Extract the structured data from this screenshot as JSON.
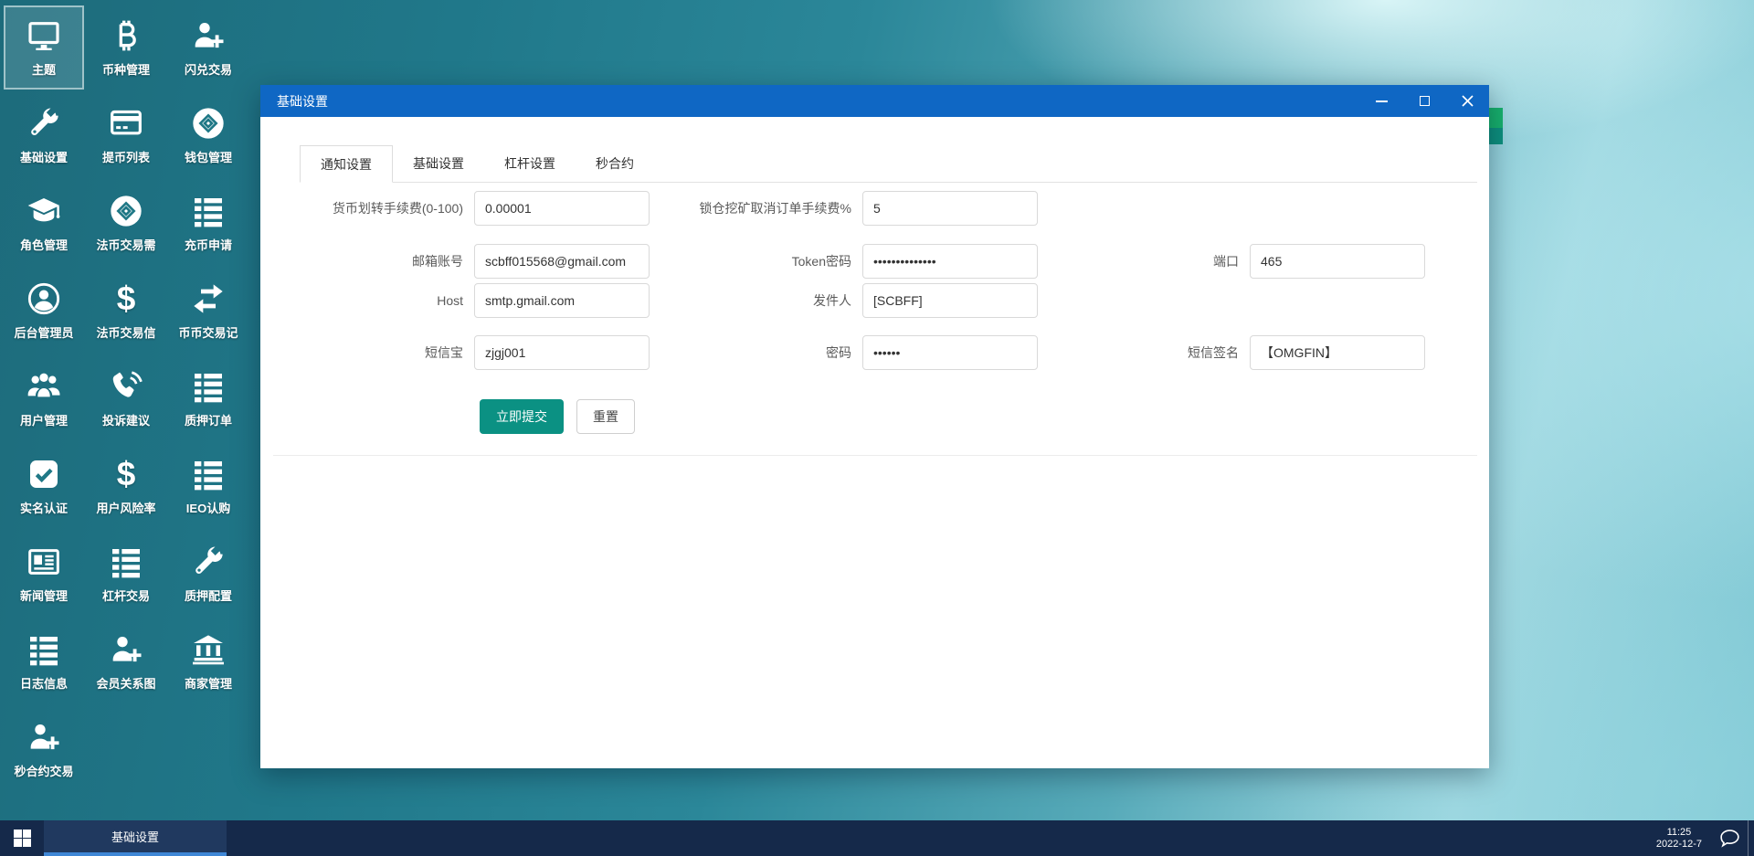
{
  "desktop": {
    "shortcuts": [
      {
        "label": "主题",
        "icon": "monitor-icon",
        "selected": true
      },
      {
        "label": "币种管理",
        "icon": "bitcoin-icon"
      },
      {
        "label": "闪兑交易",
        "icon": "user-plus-icon"
      },
      {
        "label": "基础设置",
        "icon": "wrench-icon"
      },
      {
        "label": "提币列表",
        "icon": "credit-card-icon"
      },
      {
        "label": "钱包管理",
        "icon": "coin-link-icon"
      },
      {
        "label": "角色管理",
        "icon": "graduation-cap-icon"
      },
      {
        "label": "法币交易需",
        "icon": "coin-link-icon"
      },
      {
        "label": "充币申请",
        "icon": "list-icon"
      },
      {
        "label": "后台管理员",
        "icon": "user-circle-icon"
      },
      {
        "label": "法币交易信",
        "icon": "dollar-icon"
      },
      {
        "label": "币币交易记",
        "icon": "swap-arrows-icon"
      },
      {
        "label": "用户管理",
        "icon": "users-icon"
      },
      {
        "label": "投诉建议",
        "icon": "phone-sound-icon"
      },
      {
        "label": "质押订单",
        "icon": "list-icon"
      },
      {
        "label": "实名认证",
        "icon": "check-square-icon"
      },
      {
        "label": "用户风险率",
        "icon": "dollar-icon"
      },
      {
        "label": "IEO认购",
        "icon": "list-icon"
      },
      {
        "label": "新闻管理",
        "icon": "newspaper-icon"
      },
      {
        "label": "杠杆交易",
        "icon": "list-icon"
      },
      {
        "label": "质押配置",
        "icon": "wrench-icon"
      },
      {
        "label": "日志信息",
        "icon": "list-icon"
      },
      {
        "label": "会员关系图",
        "icon": "user-plus-icon"
      },
      {
        "label": "商家管理",
        "icon": "bank-icon"
      },
      {
        "label": "秒合约交易",
        "icon": "user-plus-icon"
      }
    ]
  },
  "window": {
    "title": "基础设置",
    "tabs": [
      {
        "label": "通知设置",
        "active": true
      },
      {
        "label": "基础设置",
        "active": false
      },
      {
        "label": "杠杆设置",
        "active": false
      },
      {
        "label": "秒合约",
        "active": false
      }
    ]
  },
  "form": {
    "rows": [
      [
        {
          "col": 1,
          "label": "货币划转手续费(0-100)",
          "value": "0.00001"
        },
        {
          "col": 2,
          "label": "锁仓挖矿取消订单手续费%",
          "value": "5"
        }
      ],
      [
        {
          "col": 1,
          "label": "邮箱账号",
          "value": "scbff015568@gmail.com"
        },
        {
          "col": 2,
          "label": "Token密码",
          "value": "••••••••••••••"
        },
        {
          "col": 3,
          "label": "端口",
          "value": "465"
        }
      ],
      [
        {
          "col": 1,
          "label": "Host",
          "value": "smtp.gmail.com"
        },
        {
          "col": 2,
          "label": "发件人",
          "value": "[SCBFF]"
        }
      ],
      [
        {
          "col": 1,
          "label": "短信宝",
          "value": "zjgj001"
        },
        {
          "col": 2,
          "label": "密码",
          "value": "••••••"
        },
        {
          "col": 3,
          "label": "短信签名",
          "value": "【OMGFIN】"
        }
      ]
    ],
    "submit_label": "立即提交",
    "reset_label": "重置"
  },
  "taskbar": {
    "app_label": "基础设置",
    "clock": {
      "time": "11:25",
      "date": "2022-12-7"
    }
  },
  "colors": {
    "titlebar_blue": "#0f67c4",
    "submit_green": "#0b9183",
    "taskbar_bg": "#15294a",
    "taskbar_underline": "#3f87d6",
    "desktop_teal": "#20788a"
  }
}
